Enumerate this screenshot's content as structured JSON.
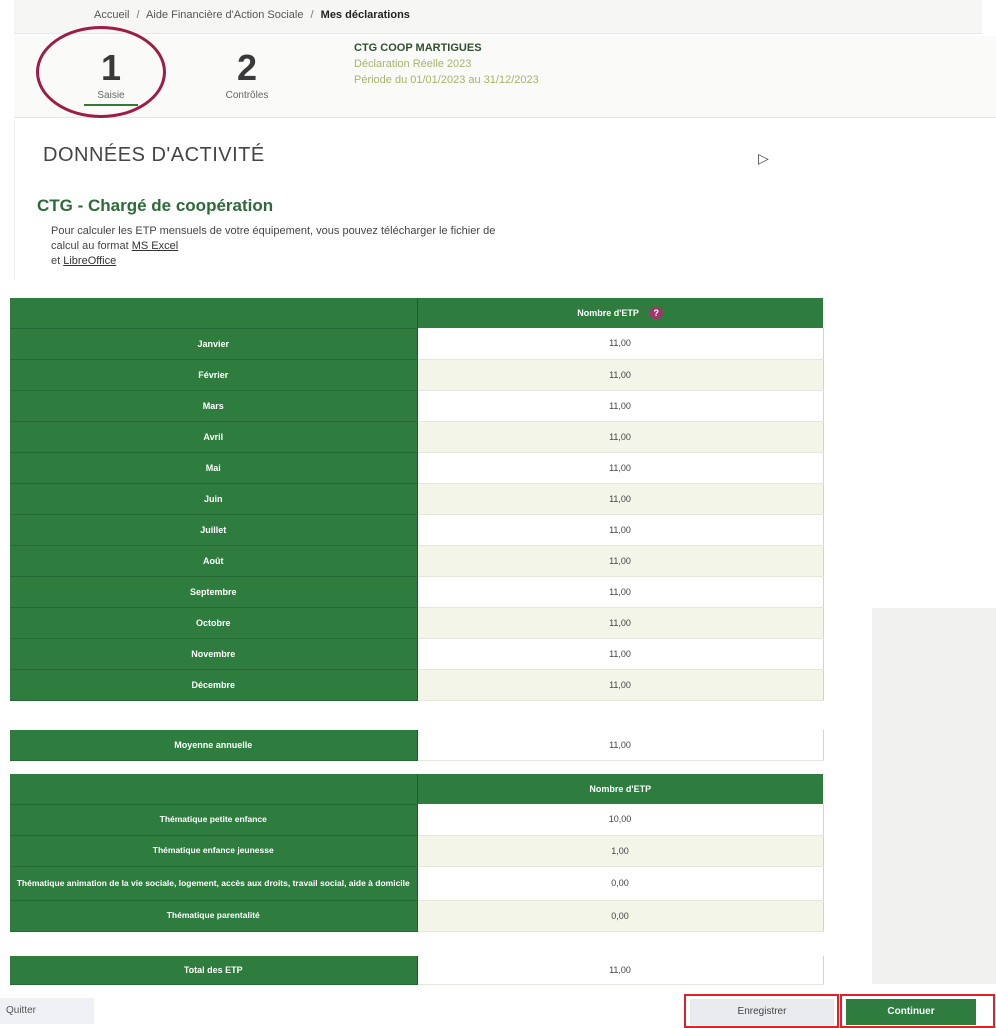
{
  "breadcrumb": {
    "home": "Accueil",
    "sep": "/",
    "section": "Aide Financière d'Action Sociale",
    "current": "Mes déclarations"
  },
  "steps": [
    {
      "number": "1",
      "label": "Saisie"
    },
    {
      "number": "2",
      "label": "Contrôles"
    }
  ],
  "declaration": {
    "name": "CTG COOP MARTIGUES",
    "type": "Déclaration Réelle 2023",
    "period": "Période du 01/01/2023 au 31/12/2023"
  },
  "page": {
    "title": "DONNÉES D'ACTIVITÉ",
    "subtitle": "CTG - Chargé de coopération",
    "intro": "Pour calculer les ETP mensuels de votre équipement, vous pouvez télécharger le fichier de calcul au format",
    "link_excel": "MS Excel",
    "and": "et",
    "link_libre": "LibreOffice"
  },
  "monthly_table": {
    "header": "Nombre d'ETP",
    "help": "?",
    "rows": [
      {
        "label": "Janvier",
        "value": "11,00"
      },
      {
        "label": "Février",
        "value": "11,00"
      },
      {
        "label": "Mars",
        "value": "11,00"
      },
      {
        "label": "Avril",
        "value": "11,00"
      },
      {
        "label": "Mai",
        "value": "11,00"
      },
      {
        "label": "Juin",
        "value": "11,00"
      },
      {
        "label": "Juillet",
        "value": "11,00"
      },
      {
        "label": "Août",
        "value": "11,00"
      },
      {
        "label": "Septembre",
        "value": "11,00"
      },
      {
        "label": "Octobre",
        "value": "11,00"
      },
      {
        "label": "Novembre",
        "value": "11,00"
      },
      {
        "label": "Décembre",
        "value": "11,00"
      }
    ]
  },
  "average": {
    "label": "Moyenne annuelle",
    "value": "11,00"
  },
  "theme_table": {
    "header": "Nombre d'ETP",
    "rows": [
      {
        "label": "Thématique petite enfance",
        "value": "10,00"
      },
      {
        "label": "Thématique enfance jeunesse",
        "value": "1,00"
      },
      {
        "label": "Thématique animation de la vie sociale, logement, accès aux droits, travail social, aide à domicile",
        "value": "0,00"
      },
      {
        "label": "Thématique parentalité",
        "value": "0,00"
      }
    ]
  },
  "total": {
    "label": "Total des ETP",
    "value": "11,00"
  },
  "buttons": {
    "quit": "Quitter",
    "save": "Enregistrer",
    "continue": "Continuer"
  },
  "colors": {
    "primary_green": "#2e7d3e",
    "annotation_circle": "#9b1d48",
    "annotation_box": "#e0202a"
  }
}
